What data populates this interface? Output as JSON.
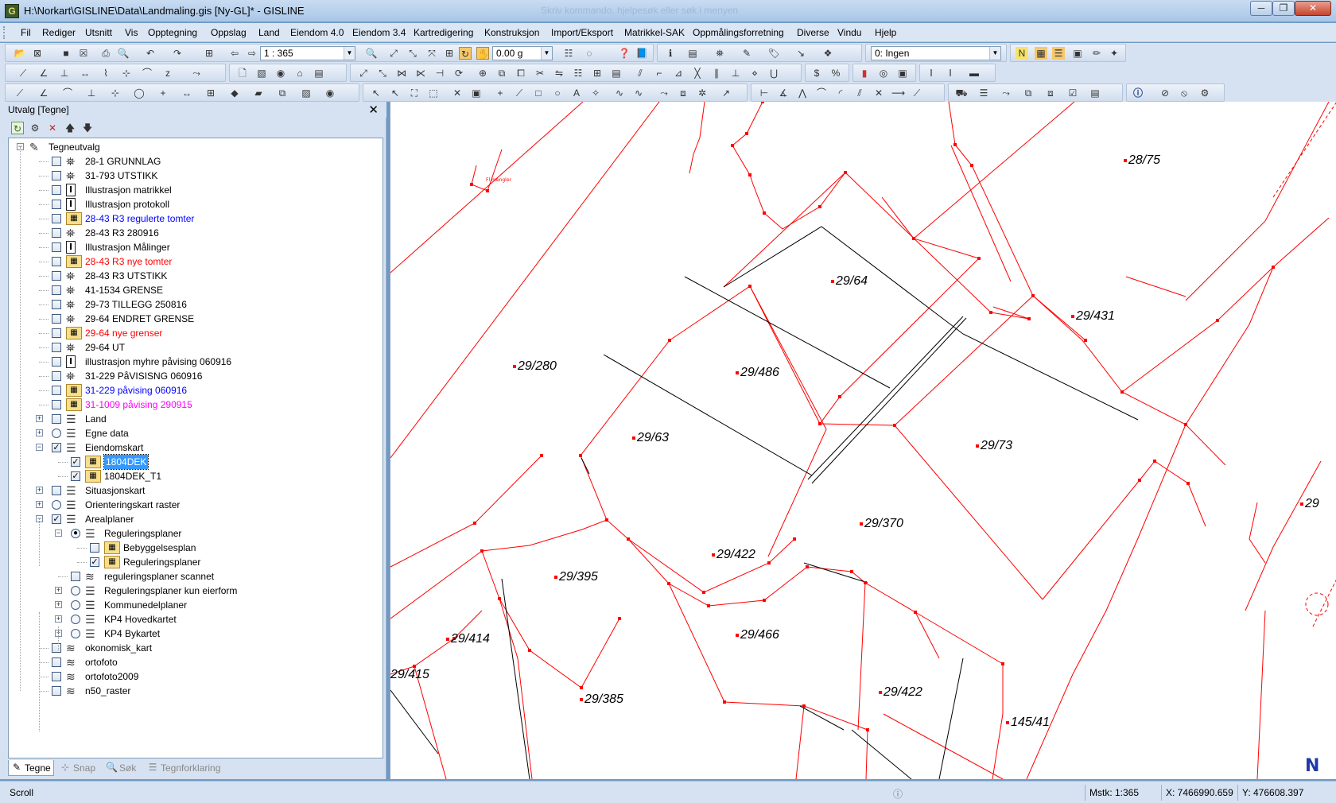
{
  "window": {
    "title": "H:\\Norkart\\GISLINE\\Data\\Landmaling.gis [Ny-GL]* - GISLINE",
    "ghost_title": "Skriv kommando, hjelpesøk eller søk i menyen",
    "btn_min": "─",
    "btn_max": "❐",
    "btn_close": "✕"
  },
  "menu": [
    "Fil",
    "Rediger",
    "Utsnitt",
    "Vis",
    "Opptegning",
    "Oppslag",
    "Land",
    "Eiendom 4.0",
    "Eiendom 3.4",
    "Kartredigering",
    "Konstruksjon",
    "Import/Eksport",
    "Matrikkel-SAK",
    "Oppmålingsforretning",
    "Diverse",
    "Vindu",
    "Hjelp"
  ],
  "toolbar": {
    "scale_value": "1 : 365",
    "angle_value": "0.00 g",
    "layer_value": "0: Ingen"
  },
  "panel": {
    "title": "Utvalg [Tegne]",
    "close": "✕",
    "tree": [
      {
        "label": "Tegneutvalg",
        "level": 0,
        "exp": "−",
        "check": "none",
        "icon": "pencil"
      },
      {
        "label": "28-1 GRUNNLAG",
        "level": 1,
        "check": "box",
        "icon": "survey",
        "color": "#000000"
      },
      {
        "label": "31-793 UTSTIKK",
        "level": 1,
        "check": "box",
        "icon": "survey",
        "color": "#000000"
      },
      {
        "label": "Illustrasjon matrikkel",
        "level": 1,
        "check": "box",
        "icon": "info",
        "color": "#000000"
      },
      {
        "label": "Illustrasjon protokoll",
        "level": 1,
        "check": "box",
        "icon": "info",
        "color": "#000000"
      },
      {
        "label": "28-43 R3 regulerte tomter",
        "level": 1,
        "check": "box",
        "icon": "edit-map",
        "color": "#0000ff"
      },
      {
        "label": "28-43 R3 280916",
        "level": 1,
        "check": "box",
        "icon": "survey",
        "color": "#000000"
      },
      {
        "label": "Illustrasjon Målinger",
        "level": 1,
        "check": "box",
        "icon": "info",
        "color": "#000000"
      },
      {
        "label": "28-43 R3 nye tomter",
        "level": 1,
        "check": "box",
        "icon": "edit-map",
        "color": "#ff0000"
      },
      {
        "label": "28-43 R3 UTSTIKK",
        "level": 1,
        "check": "box",
        "icon": "survey",
        "color": "#000000"
      },
      {
        "label": "41-1534 GRENSE",
        "level": 1,
        "check": "box",
        "icon": "survey",
        "color": "#000000"
      },
      {
        "label": "29-73 TILLEGG 250816",
        "level": 1,
        "check": "box",
        "icon": "survey",
        "color": "#000000"
      },
      {
        "label": "29-64 ENDRET GRENSE",
        "level": 1,
        "check": "box",
        "icon": "survey",
        "color": "#000000"
      },
      {
        "label": "29-64 nye grenser",
        "level": 1,
        "check": "box",
        "icon": "edit-map",
        "color": "#ff0000"
      },
      {
        "label": "29-64 UT",
        "level": 1,
        "check": "box",
        "icon": "survey",
        "color": "#000000"
      },
      {
        "label": "illustrasjon myhre påvising 060916",
        "level": 1,
        "check": "box",
        "icon": "info",
        "color": "#000000"
      },
      {
        "label": "31-229 PåVISISNG 060916",
        "level": 1,
        "check": "box",
        "icon": "survey",
        "color": "#000000"
      },
      {
        "label": "31-229 påvising 060916",
        "level": 1,
        "check": "box",
        "icon": "edit-map",
        "color": "#0000ff"
      },
      {
        "label": "31-1009 påvising 290915",
        "level": 1,
        "check": "box",
        "icon": "edit-map",
        "color": "#ff00ff"
      },
      {
        "label": "Land",
        "level": 1,
        "exp": "+",
        "check": "box",
        "icon": "layers",
        "color": "#000000"
      },
      {
        "label": "Egne data",
        "level": 1,
        "exp": "+",
        "check": "radio",
        "icon": "layers",
        "color": "#000000"
      },
      {
        "label": "Eiendomskart",
        "level": 1,
        "exp": "−",
        "check": "checked",
        "icon": "layers-edit",
        "color": "#000000"
      },
      {
        "label": "1804DEK",
        "level": 2,
        "check": "checked",
        "icon": "edit-map",
        "color": "#000000",
        "selected": true
      },
      {
        "label": "1804DEK_T1",
        "level": 2,
        "check": "checked",
        "icon": "edit-map",
        "color": "#000000"
      },
      {
        "label": "Situasjonskart",
        "level": 1,
        "exp": "+",
        "check": "box",
        "icon": "layers-edit",
        "color": "#000000"
      },
      {
        "label": "Orienteringskart raster",
        "level": 1,
        "exp": "+",
        "check": "radio",
        "icon": "layers",
        "color": "#000000"
      },
      {
        "label": "Arealplaner",
        "level": 1,
        "exp": "−",
        "check": "checked",
        "icon": "layers",
        "color": "#000000"
      },
      {
        "label": "Reguleringsplaner",
        "level": 2,
        "exp": "−",
        "check": "radio-on",
        "icon": "layers-edit",
        "color": "#000000"
      },
      {
        "label": "Bebyggelsesplan",
        "level": 3,
        "check": "box",
        "icon": "edit-map",
        "color": "#000000"
      },
      {
        "label": "Reguleringsplaner",
        "level": 3,
        "check": "checked",
        "icon": "map",
        "color": "#000000"
      },
      {
        "label": "reguleringsplaner scannet",
        "level": 2,
        "check": "box",
        "icon": "raster",
        "color": "#000000"
      },
      {
        "label": "Reguleringsplaner kun eierform",
        "level": 2,
        "exp": "+",
        "check": "radio",
        "icon": "layers",
        "color": "#000000"
      },
      {
        "label": "Kommunedelplaner",
        "level": 2,
        "exp": "+",
        "check": "radio",
        "icon": "layers",
        "color": "#000000"
      },
      {
        "label": "KP4 Hovedkartet",
        "level": 2,
        "exp": "+",
        "check": "radio",
        "icon": "layers",
        "color": "#000000"
      },
      {
        "label": "KP4 Bykartet",
        "level": 2,
        "exp": "+",
        "check": "radio",
        "icon": "layers",
        "color": "#000000"
      },
      {
        "label": "okonomisk_kart",
        "level": 1,
        "check": "box",
        "icon": "raster",
        "color": "#000000"
      },
      {
        "label": "ortofoto",
        "level": 1,
        "check": "box",
        "icon": "raster",
        "color": "#000000"
      },
      {
        "label": "ortofoto2009",
        "level": 1,
        "check": "box",
        "icon": "raster",
        "color": "#000000"
      },
      {
        "label": "n50_raster",
        "level": 1,
        "check": "box",
        "icon": "raster",
        "color": "#000000"
      }
    ],
    "tabs": [
      {
        "label": "Tegne",
        "icon": "pencil-icon",
        "active": true
      },
      {
        "label": "Snap",
        "icon": "snap-icon",
        "active": false
      },
      {
        "label": "Søk",
        "icon": "search-icon",
        "active": false
      },
      {
        "label": "Tegnforklaring",
        "icon": "legend-icon",
        "active": false
      }
    ]
  },
  "map": {
    "parcels": [
      "28/75",
      "29/64",
      "29/431",
      "29/280",
      "29/486",
      "29/63",
      "29/73",
      "29/370",
      "29/422",
      "29/395",
      "29/466",
      "29/414",
      "29/415",
      "29/385",
      "29/422",
      "145/41",
      "29"
    ],
    "small_note": "Fl mengler",
    "north_arrow": "N",
    "line_color": "#ff0000",
    "aux_line_color": "#000000"
  },
  "status": {
    "mode": "Scroll",
    "scale": "Mstk: 1:365",
    "x": "X: 7466990.659",
    "y": "Y: 476608.397"
  }
}
